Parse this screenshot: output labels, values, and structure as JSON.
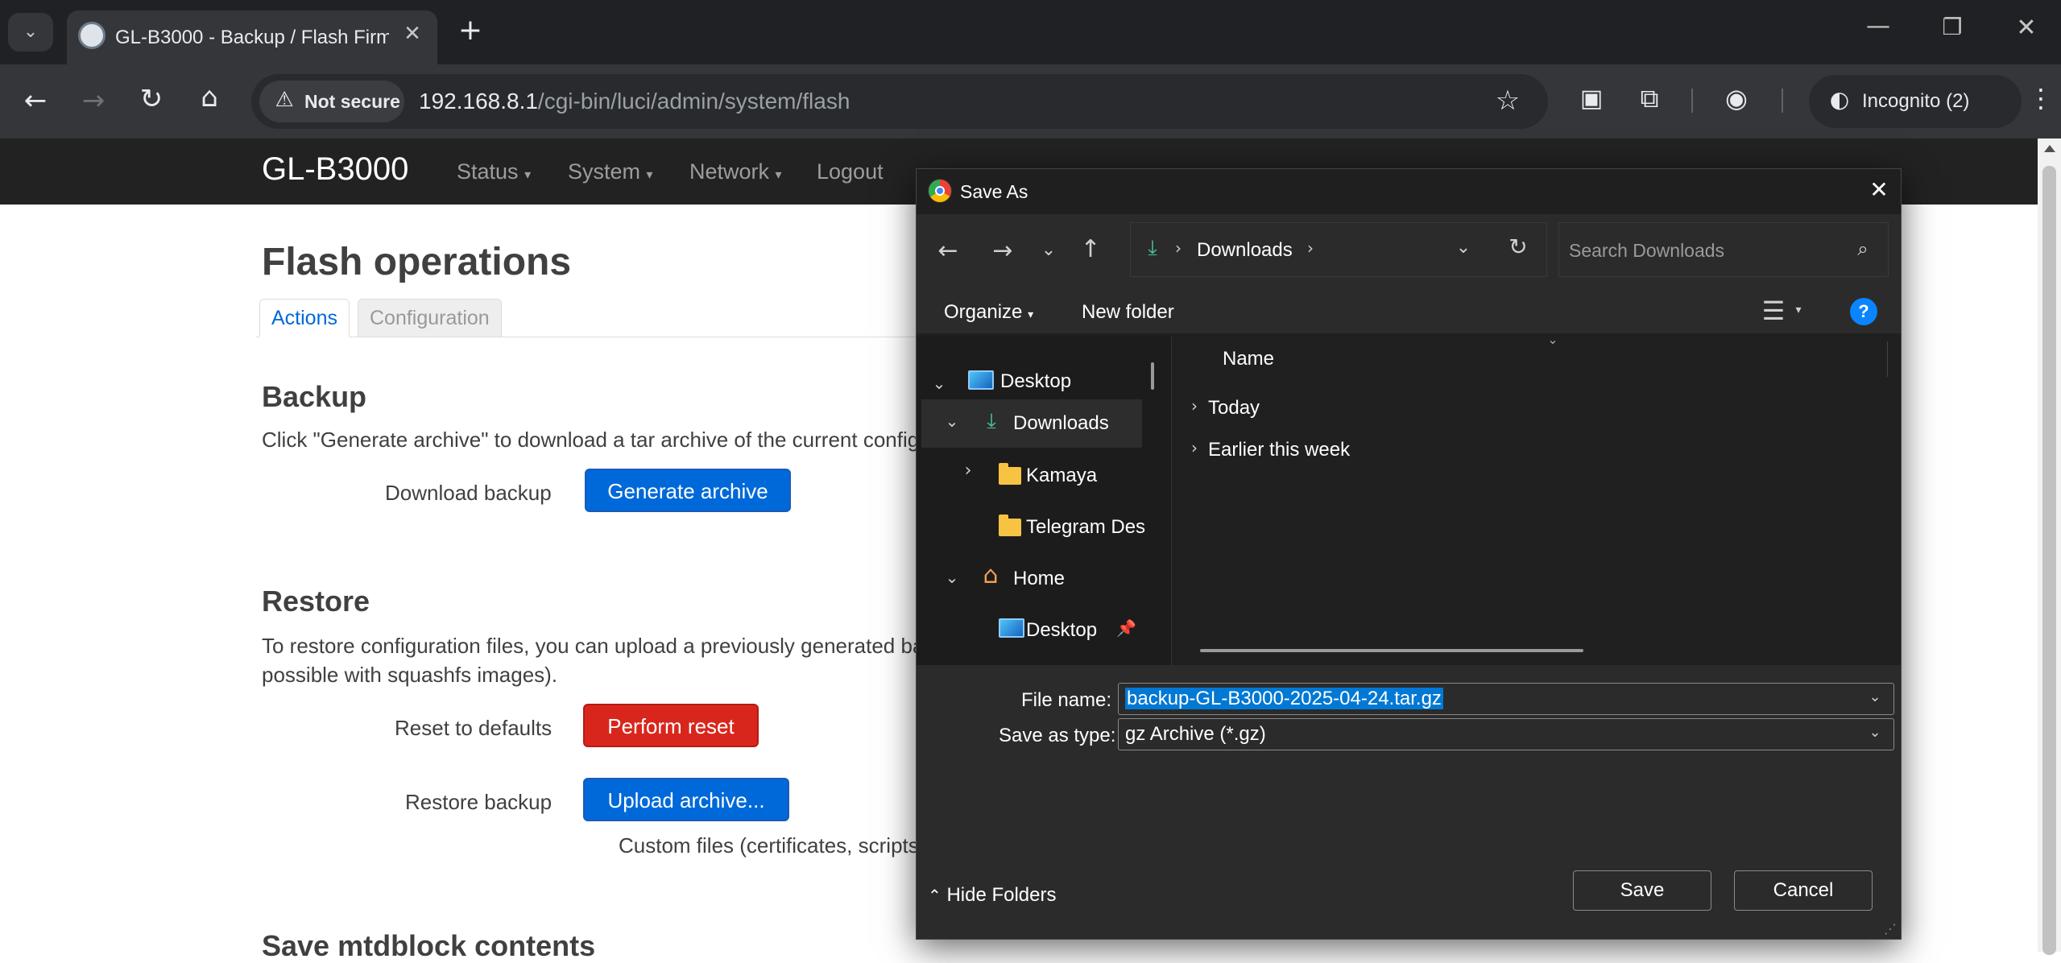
{
  "browser": {
    "tab_title": "GL-B3000 - Backup / Flash Firm",
    "new_tab": "+",
    "not_secure": "Not secure",
    "url_host": "192.168.8.1",
    "url_path": "/cgi-bin/luci/admin/system/flash",
    "incognito": "Incognito (2)"
  },
  "page": {
    "brand": "GL-B3000",
    "nav": [
      "Status",
      "System",
      "Network",
      "Logout"
    ],
    "title": "Flash operations",
    "tabs": [
      "Actions",
      "Configuration"
    ],
    "backup": {
      "heading": "Backup",
      "desc": "Click \"Generate archive\" to download a tar archive of the current config",
      "label": "Download backup",
      "button": "Generate archive"
    },
    "restore": {
      "heading": "Restore",
      "desc1": "To restore configuration files, you can upload a previously generated ba",
      "desc2": "possible with squashfs images).",
      "reset_label": "Reset to defaults",
      "reset_button": "Perform reset",
      "restore_label": "Restore backup",
      "upload_button": "Upload archive...",
      "custom_files": "Custom files (certificates, scripts"
    },
    "mtd_heading": "Save mtdblock contents"
  },
  "dialog": {
    "title": "Save As",
    "breadcrumb": "Downloads",
    "search_placeholder": "Search Downloads",
    "organize": "Organize",
    "new_folder": "New folder",
    "help": "?",
    "tree": [
      "Desktop",
      "Downloads",
      "Kamaya",
      "Telegram Des",
      "Home",
      "Desktop"
    ],
    "column_name": "Name",
    "groups": [
      "Today",
      "Earlier this week"
    ],
    "file_name_label": "File name:",
    "file_name": "backup-GL-B3000-2025-04-24.tar.gz",
    "save_type_label": "Save as type:",
    "save_type": "gz Archive (*.gz)",
    "hide_folders": "Hide Folders",
    "save": "Save",
    "cancel": "Cancel"
  },
  "colors": {
    "primary_button": "#0069d9",
    "danger_button": "#d9261c",
    "navbar": "#222222",
    "dialog_bg": "#202020",
    "selection": "#0078d4"
  }
}
